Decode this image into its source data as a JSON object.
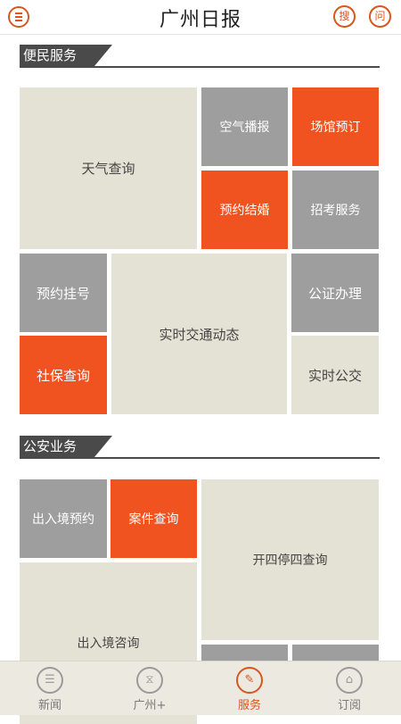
{
  "header": {
    "title": "广州日报",
    "search_label": "搜",
    "ask_label": "问"
  },
  "sections": {
    "convenience": {
      "title": "便民服务",
      "tiles": {
        "weather": "天气查询",
        "air": "空气播报",
        "venue": "场馆预订",
        "marriage": "预约结婚",
        "exam": "招考服务",
        "register": "预约挂号",
        "traffic": "实时交通动态",
        "notary": "公证办理",
        "social": "社保查询",
        "bus": "实时公交"
      }
    },
    "police": {
      "title": "公安业务",
      "tiles": {
        "exit_booking": "出入境预约",
        "case_query": "案件查询",
        "kaisi": "开四停四查询",
        "exit_consult": "出入境咨询"
      }
    }
  },
  "bottom_nav": {
    "items": [
      {
        "label": "新闻",
        "icon": "news-icon"
      },
      {
        "label": "广州+",
        "icon": "guangzhou-plus-icon"
      },
      {
        "label": "服务",
        "icon": "service-icon"
      },
      {
        "label": "订阅",
        "icon": "subscribe-icon"
      }
    ],
    "active": "服务"
  },
  "colors": {
    "accent": "#d7571f",
    "tile_orange": "#f0531f",
    "tile_gray": "#9e9e9e",
    "tile_beige": "#e4e2d5",
    "heading_dark": "#4a4a4a"
  }
}
